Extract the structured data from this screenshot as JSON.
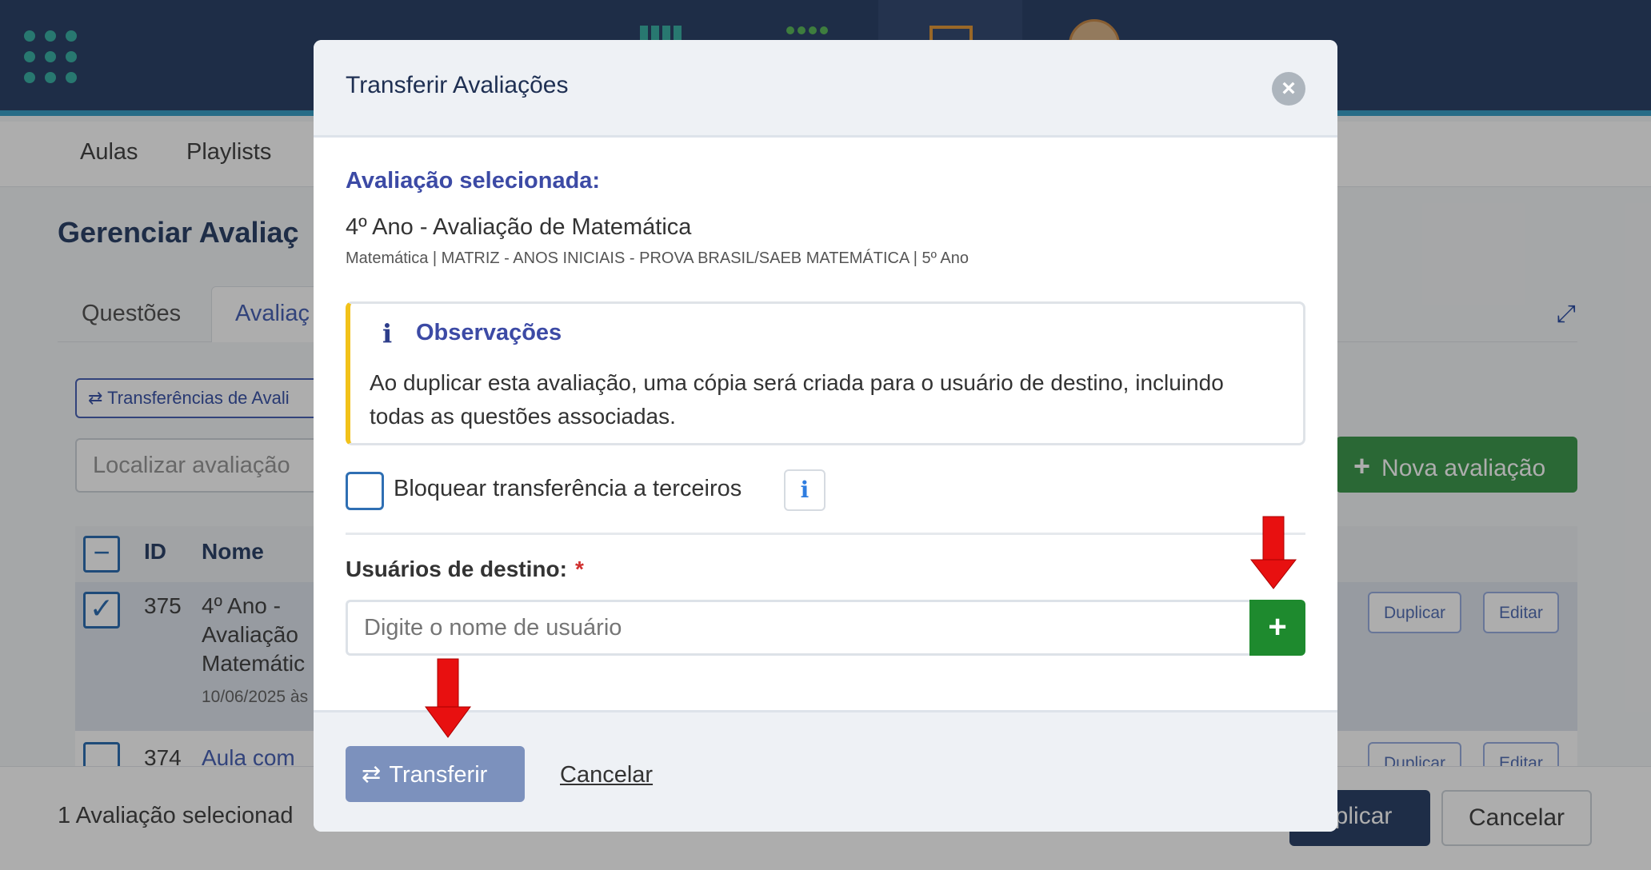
{
  "background": {
    "subnav": {
      "items": [
        "Aulas",
        "Playlists"
      ]
    },
    "page_title": "Gerenciar Avaliaç",
    "tabs": [
      "Questões",
      "Avaliaç"
    ],
    "transfers_button": "⇄ Transferências de Avali",
    "search_placeholder": "Localizar avaliação",
    "new_button": "Nova avaliação",
    "table": {
      "headers": {
        "id": "ID",
        "name": "Nome"
      },
      "rows": [
        {
          "id": "375",
          "name_lines": [
            "4º Ano -",
            "Avaliação",
            "Matemátic"
          ],
          "date": "10/06/2025 às"
        },
        {
          "id": "374",
          "name_lines": [
            "Aula com"
          ]
        }
      ],
      "row_buttons": {
        "duplicate": "Duplicar",
        "edit": "Editar"
      }
    },
    "footer": {
      "selected_text": "1 Avaliação selecionad",
      "duplicate": "uplicar",
      "cancel": "Cancelar"
    }
  },
  "modal": {
    "title": "Transferir Avaliações",
    "close_icon": "close-icon",
    "selected_label": "Avaliação selecionada:",
    "selected_title": "4º Ano - Avaliação de Matemática",
    "selected_subtitle": "Matemática | MATRIZ - ANOS INICIAIS - PROVA BRASIL/SAEB MATEMÁTICA | 5º Ano",
    "observations": {
      "title": "Observações",
      "text": "Ao duplicar esta avaliação, uma cópia será criada para o usuário de destino, incluindo todas as questões associadas."
    },
    "block_label": "Bloquear transferência a terceiros",
    "dest_label": "Usuários de destino:",
    "required_mark": "*",
    "dest_placeholder": "Digite o nome de usuário",
    "add_symbol": "+",
    "transfer_button": "Transferir",
    "cancel_link": "Cancelar"
  },
  "colors": {
    "topbar": "#2d4369",
    "accent_blue": "#3c4aa5",
    "add_green": "#1e8a2e",
    "transfer_btn": "#7c91bd",
    "warning_border": "#f2c21a",
    "annotation_red": "#e81010"
  }
}
